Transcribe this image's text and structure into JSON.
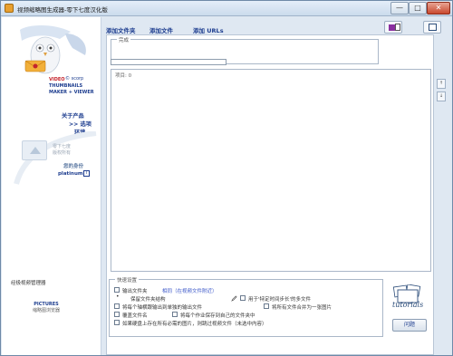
{
  "window": {
    "title": "视频缩略图生成器-零下七度汉化版",
    "minimize": "—",
    "maximize": "□",
    "close": "✕"
  },
  "sidebar": {
    "scorp": "© scorp",
    "product_line1": "VIDEO",
    "product_line2": "THUMBNAILS",
    "product_line3": "MAKER + VIEWER",
    "nav": [
      {
        "label": "关于产品"
      },
      {
        "label": ">> 选项"
      },
      {
        "label": "环境"
      }
    ],
    "promo_text": "零下七度\n版权所有",
    "identity_label": "您的身份",
    "identity_value": "platinum",
    "info_icon": "i",
    "manager_link": "经极视频管理器",
    "pictures_title": "PICTURES",
    "pictures_sub": "缩略图浏览器"
  },
  "toolbar": {
    "add_folder": "添加文件夹",
    "add_file": "添加文件",
    "add_urls": "添加 URLs"
  },
  "main": {
    "done_label": "完成",
    "progress_value": 0,
    "items_label": "项目: 0",
    "side_up": "↑",
    "side_down": "↓"
  },
  "quick": {
    "title": "快速设置",
    "output_folder": "输出文件夹",
    "output_folder_value": "相同（在视频文件附近）",
    "keep_structure": "保留文件夹结构",
    "use_interval": "用于'特定时间步长'的多文件",
    "split_output": "将每个轴横跟输出到单独的输出文件",
    "merge_one": "将所有文件合并为一张图片",
    "overwrite": "覆盖文件名",
    "save_own_folder": "将每个作业保存到自己的文件夹中",
    "skip_existing": "如果硬盘上存在所有必需的图片，则跳过视频文件（未选中内容）"
  },
  "help": {
    "tutorials": "tutorials",
    "button": "问题"
  }
}
